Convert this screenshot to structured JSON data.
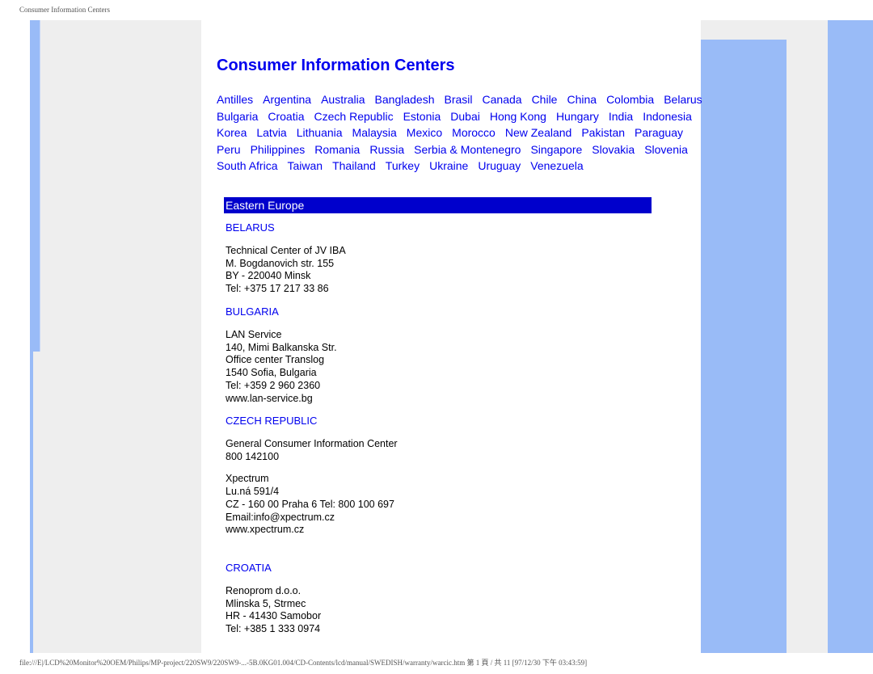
{
  "print_header": "Consumer Information Centers",
  "print_footer": "file:///E|/LCD%20Monitor%20OEM/Philips/MP-project/220SW9/220SW9-...-5B.0KG01.004/CD-Contents/lcd/manual/SWEDISH/warranty/warcic.htm 第 1 頁 / 共 11 [97/12/30 下午 03:43:59]",
  "page_title": "Consumer Information Centers",
  "country_rows": [
    [
      "Antilles",
      "Argentina",
      "Australia",
      "Bangladesh",
      "Brasil",
      "Canada",
      "Chile",
      "China",
      "Colombia",
      "Belarus"
    ],
    [
      "Bulgaria",
      "Croatia",
      "Czech Republic",
      "Estonia",
      "Dubai",
      "Hong Kong",
      "Hungary",
      "India",
      "Indonesia"
    ],
    [
      "Korea",
      "Latvia",
      "Lithuania",
      "Malaysia",
      "Mexico",
      "Morocco",
      "New Zealand",
      "Pakistan",
      "Paraguay"
    ],
    [
      "Peru",
      "Philippines",
      "Romania",
      "Russia",
      "Serbia & Montenegro",
      "Singapore",
      "Slovakia",
      "Slovenia"
    ],
    [
      "South Africa",
      "Taiwan",
      "Thailand",
      "Turkey",
      "Ukraine",
      "Uruguay",
      "Venezuela"
    ]
  ],
  "region": "Eastern Europe",
  "sections": {
    "belarus": {
      "heading": "BELARUS",
      "lines": [
        "Technical Center of JV IBA",
        "M. Bogdanovich str. 155",
        "BY - 220040 Minsk",
        "Tel: +375 17 217 33 86"
      ]
    },
    "bulgaria": {
      "heading": "BULGARIA",
      "lines": [
        "LAN Service",
        "140, Mimi Balkanska Str.",
        "Office center Translog",
        "1540 Sofia, Bulgaria",
        "Tel: +359 2 960 2360",
        "www.lan-service.bg"
      ]
    },
    "czech": {
      "heading": "CZECH REPUBLIC",
      "block1": [
        "General Consumer Information Center",
        "800 142100"
      ],
      "block2": [
        "Xpectrum",
        "Lu.ná 591/4",
        "CZ - 160 00 Praha 6 Tel: 800 100 697",
        "Email:info@xpectrum.cz",
        "www.xpectrum.cz"
      ]
    },
    "croatia": {
      "heading": "CROATIA",
      "lines": [
        "Renoprom d.o.o.",
        "Mlinska 5, Strmec",
        "HR - 41430 Samobor",
        "Tel: +385 1 333 0974"
      ]
    }
  }
}
